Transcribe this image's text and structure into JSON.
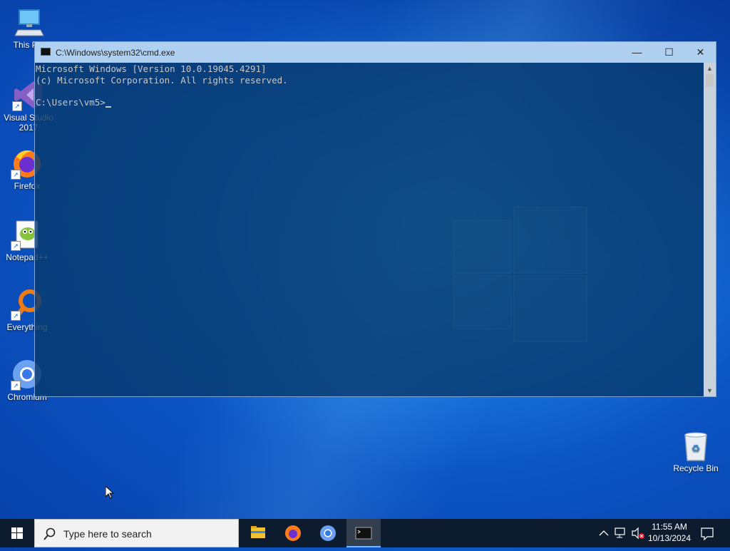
{
  "desktop": {
    "icons": [
      {
        "label": "This PC"
      },
      {
        "label": "Visual Studio 2017"
      },
      {
        "label": "Firefox"
      },
      {
        "label": "Notepad++"
      },
      {
        "label": "Everything"
      },
      {
        "label": "Chromium"
      }
    ],
    "recycle_bin": {
      "label": "Recycle Bin"
    }
  },
  "cmd": {
    "title": "C:\\Windows\\system32\\cmd.exe",
    "line1": "Microsoft Windows [Version 10.0.19045.4291]",
    "line2": "(c) Microsoft Corporation. All rights reserved.",
    "prompt": "C:\\Users\\vm5>",
    "controls": {
      "minimize": "—",
      "maximize": "☐",
      "close": "✕"
    }
  },
  "taskbar": {
    "search_placeholder": "Type here to search",
    "apps": [
      "file-explorer",
      "firefox",
      "chromium",
      "cmd"
    ],
    "clock": {
      "time": "11:55 AM",
      "date": "10/13/2024"
    }
  },
  "colors": {
    "taskbar": "#0d1b2e",
    "cmd_background": "#0a3a6e",
    "cmd_title": "#bedcfa"
  }
}
